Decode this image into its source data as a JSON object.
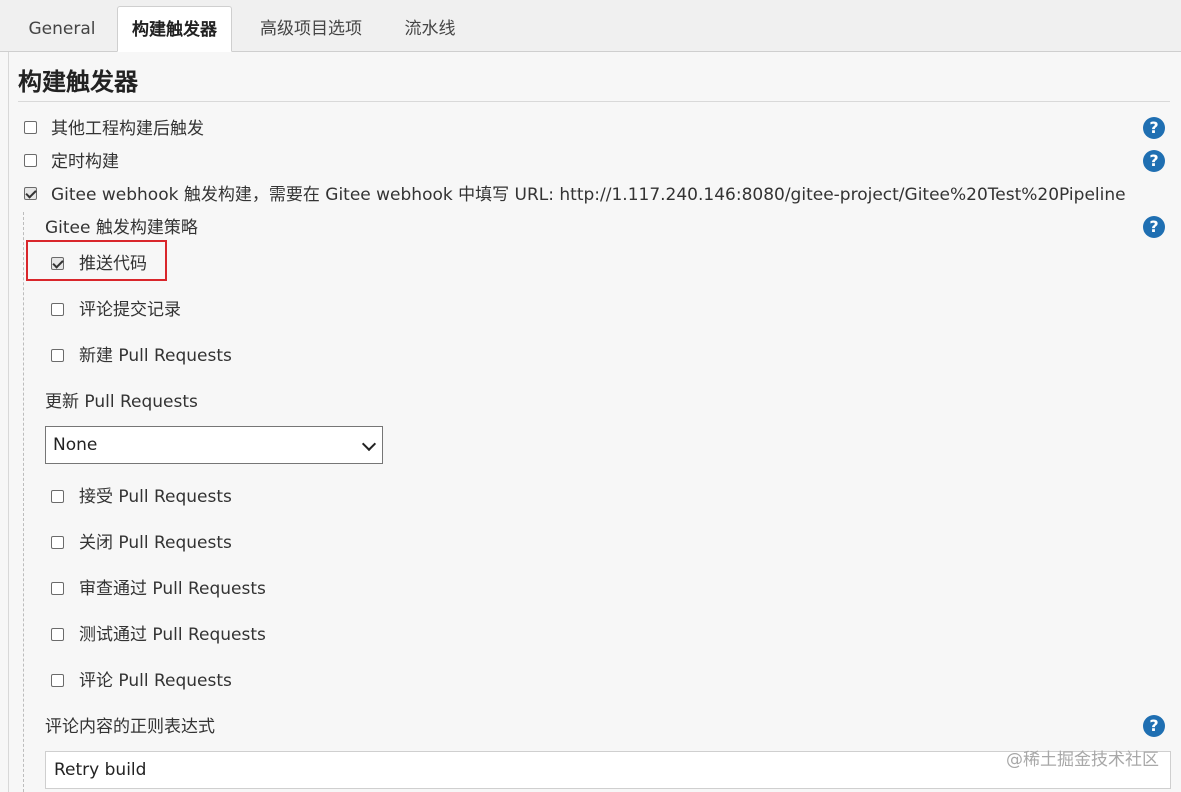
{
  "tabs": [
    {
      "label": "General",
      "active": false
    },
    {
      "label": "构建触发器",
      "active": true
    },
    {
      "label": "高级项目选项",
      "active": false
    },
    {
      "label": "流水线",
      "active": false
    }
  ],
  "section": {
    "title": "构建触发器"
  },
  "triggers": {
    "other_project": {
      "label": "其他工程构建后触发",
      "checked": false
    },
    "scheduled": {
      "label": "定时构建",
      "checked": false
    },
    "gitee_webhook": {
      "label": "Gitee webhook 触发构建，需要在 Gitee webhook 中填写 URL: http://1.117.240.146:8080/gitee-project/Gitee%20Test%20Pipeline",
      "checked": true
    }
  },
  "gitee_strategy": {
    "label": "Gitee 触发构建策略",
    "push_code": {
      "label": "推送代码",
      "checked": true
    },
    "comment_commit": {
      "label": "评论提交记录",
      "checked": false
    },
    "new_pr": {
      "label": "新建 Pull Requests",
      "checked": false
    },
    "update_pr_label": "更新 Pull Requests",
    "update_pr_select": {
      "value": "None"
    },
    "accept_pr": {
      "label": "接受 Pull Requests",
      "checked": false
    },
    "close_pr": {
      "label": "关闭 Pull Requests",
      "checked": false
    },
    "review_pass_pr": {
      "label": "审查通过 Pull Requests",
      "checked": false
    },
    "test_pass_pr": {
      "label": "测试通过 Pull Requests",
      "checked": false
    },
    "comment_pr": {
      "label": "评论 Pull Requests",
      "checked": false
    },
    "comment_regex_label": "评论内容的正则表达式",
    "comment_regex_value": "Retry build"
  },
  "help_icon_glyph": "?",
  "watermark": "@稀土掘金技术社区",
  "colors": {
    "help_icon": "#1f6fb2",
    "highlight_border": "#d9262b"
  }
}
